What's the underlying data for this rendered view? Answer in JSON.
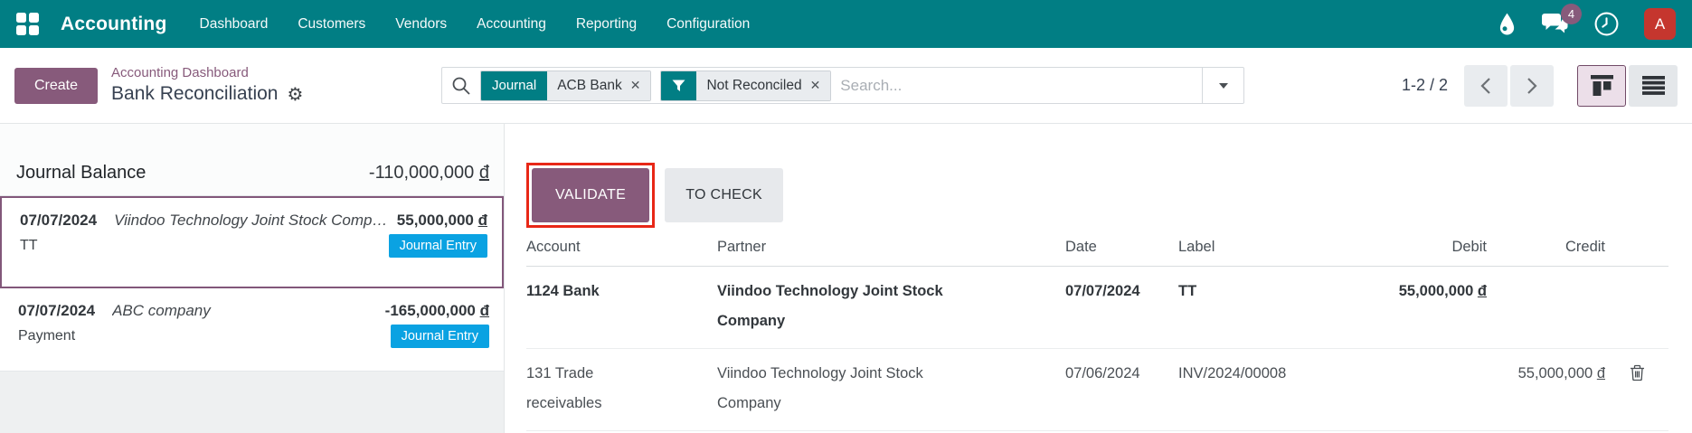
{
  "colors": {
    "teal": "#017e84",
    "purple": "#875A7B",
    "purple_dark": "#714B67",
    "badge_blue": "#0aa2e2",
    "avatar_red": "#c5362e",
    "annotation_red": "#e82717",
    "kanban_active_bg": "#ecdfe9"
  },
  "icons": {
    "apps": "grid-2x2",
    "drop": "water-drop",
    "messages": "chat-bubbles",
    "activity": "clock",
    "search": "magnifier",
    "filter": "funnel",
    "remove_facet": "✕",
    "expand": "▾",
    "previous": "‹",
    "next": "›",
    "kanban_view": "kanban-columns",
    "list_view": "≡",
    "settings": "⚙",
    "delete": "trash"
  },
  "topbar": {
    "brand": "Accounting",
    "menus": [
      "Dashboard",
      "Customers",
      "Vendors",
      "Accounting",
      "Reporting",
      "Configuration"
    ],
    "message_count": "4",
    "avatar_letter": "A"
  },
  "control_panel": {
    "create_label": "Create",
    "breadcrumb_parent": "Accounting Dashboard",
    "breadcrumb_current": "Bank Reconciliation",
    "search": {
      "facets": [
        {
          "label": "Journal",
          "value": "ACB Bank"
        },
        {
          "label": "",
          "value": "Not Reconciled"
        }
      ],
      "placeholder": "Search..."
    },
    "pager": {
      "text": "1-2 / 2"
    }
  },
  "kanban": {
    "balance_label": "Journal Balance",
    "balance_amount": "-110,000,000",
    "currency": "đ",
    "cards": [
      {
        "date": "07/07/2024",
        "partner": "Viindoo Technology Joint Stock Company",
        "amount": "55,000,000",
        "ref": "TT",
        "badge": "Journal Entry"
      },
      {
        "date": "07/07/2024",
        "partner": "ABC company",
        "amount": "-165,000,000",
        "ref": "Payment",
        "badge": "Journal Entry"
      }
    ]
  },
  "main": {
    "validate_label": "VALIDATE",
    "to_check_label": "TO CHECK",
    "table": {
      "headers": [
        "Account",
        "Partner",
        "Date",
        "Label",
        "Debit",
        "Credit"
      ],
      "rows": [
        {
          "account": "1124 Bank",
          "partner": "Viindoo Technology Joint Stock Company",
          "date": "07/07/2024",
          "label": "TT",
          "debit": "55,000,000",
          "credit": ""
        },
        {
          "account": "131 Trade receivables",
          "partner": "Viindoo Technology Joint Stock Company",
          "date": "07/06/2024",
          "label": "INV/2024/00008",
          "debit": "",
          "credit": "55,000,000"
        }
      ]
    }
  }
}
